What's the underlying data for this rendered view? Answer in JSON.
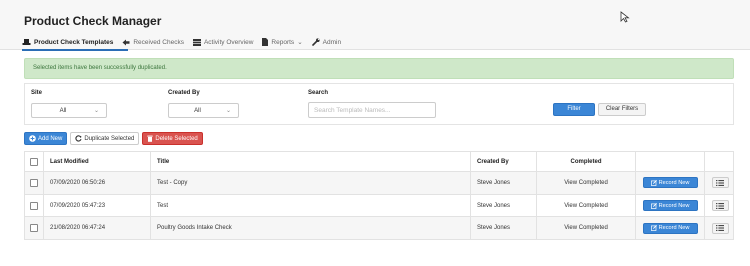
{
  "app": {
    "title": "Product Check Manager"
  },
  "nav": [
    {
      "label": "Product Check Templates",
      "icon": "hat-icon",
      "active": true
    },
    {
      "label": "Received Checks",
      "icon": "arrow-left-icon"
    },
    {
      "label": "Activity Overview",
      "icon": "grid-icon"
    },
    {
      "label": "Reports",
      "icon": "document-icon",
      "caret": "⌄"
    },
    {
      "label": "Admin",
      "icon": "wrench-icon"
    }
  ],
  "alert": {
    "message": "Selected items have been successfully duplicated."
  },
  "filters": {
    "site_label": "Site",
    "site_value": "All",
    "created_by_label": "Created By",
    "created_by_value": "All",
    "search_label": "Search",
    "search_placeholder": "Search Template Names...",
    "filter_button": "Filter",
    "clear_button": "Clear Filters"
  },
  "actions": {
    "add_new": "Add New",
    "duplicate_selected": "Duplicate Selected",
    "delete_selected": "Delete Selected"
  },
  "table": {
    "headers": {
      "last_modified": "Last Modified",
      "title": "Title",
      "created_by": "Created By",
      "completed": "Completed"
    },
    "rows": [
      {
        "last_modified": "07/09/2020 06:50:26",
        "title": "Test - Copy",
        "created_by": "Steve Jones",
        "completed": "View Completed",
        "record_label": "Record New"
      },
      {
        "last_modified": "07/09/2020 05:47:23",
        "title": "Test",
        "created_by": "Steve Jones",
        "completed": "View Completed",
        "record_label": "Record New"
      },
      {
        "last_modified": "21/08/2020 06:47:24",
        "title": "Poultry Goods Intake Check",
        "created_by": "Steve Jones",
        "completed": "View Completed",
        "record_label": "Record New"
      }
    ]
  },
  "colors": {
    "primary": "#3b86d6",
    "danger": "#d9534f",
    "success_bg": "#cfe8c9",
    "success_text": "#3c763d"
  }
}
